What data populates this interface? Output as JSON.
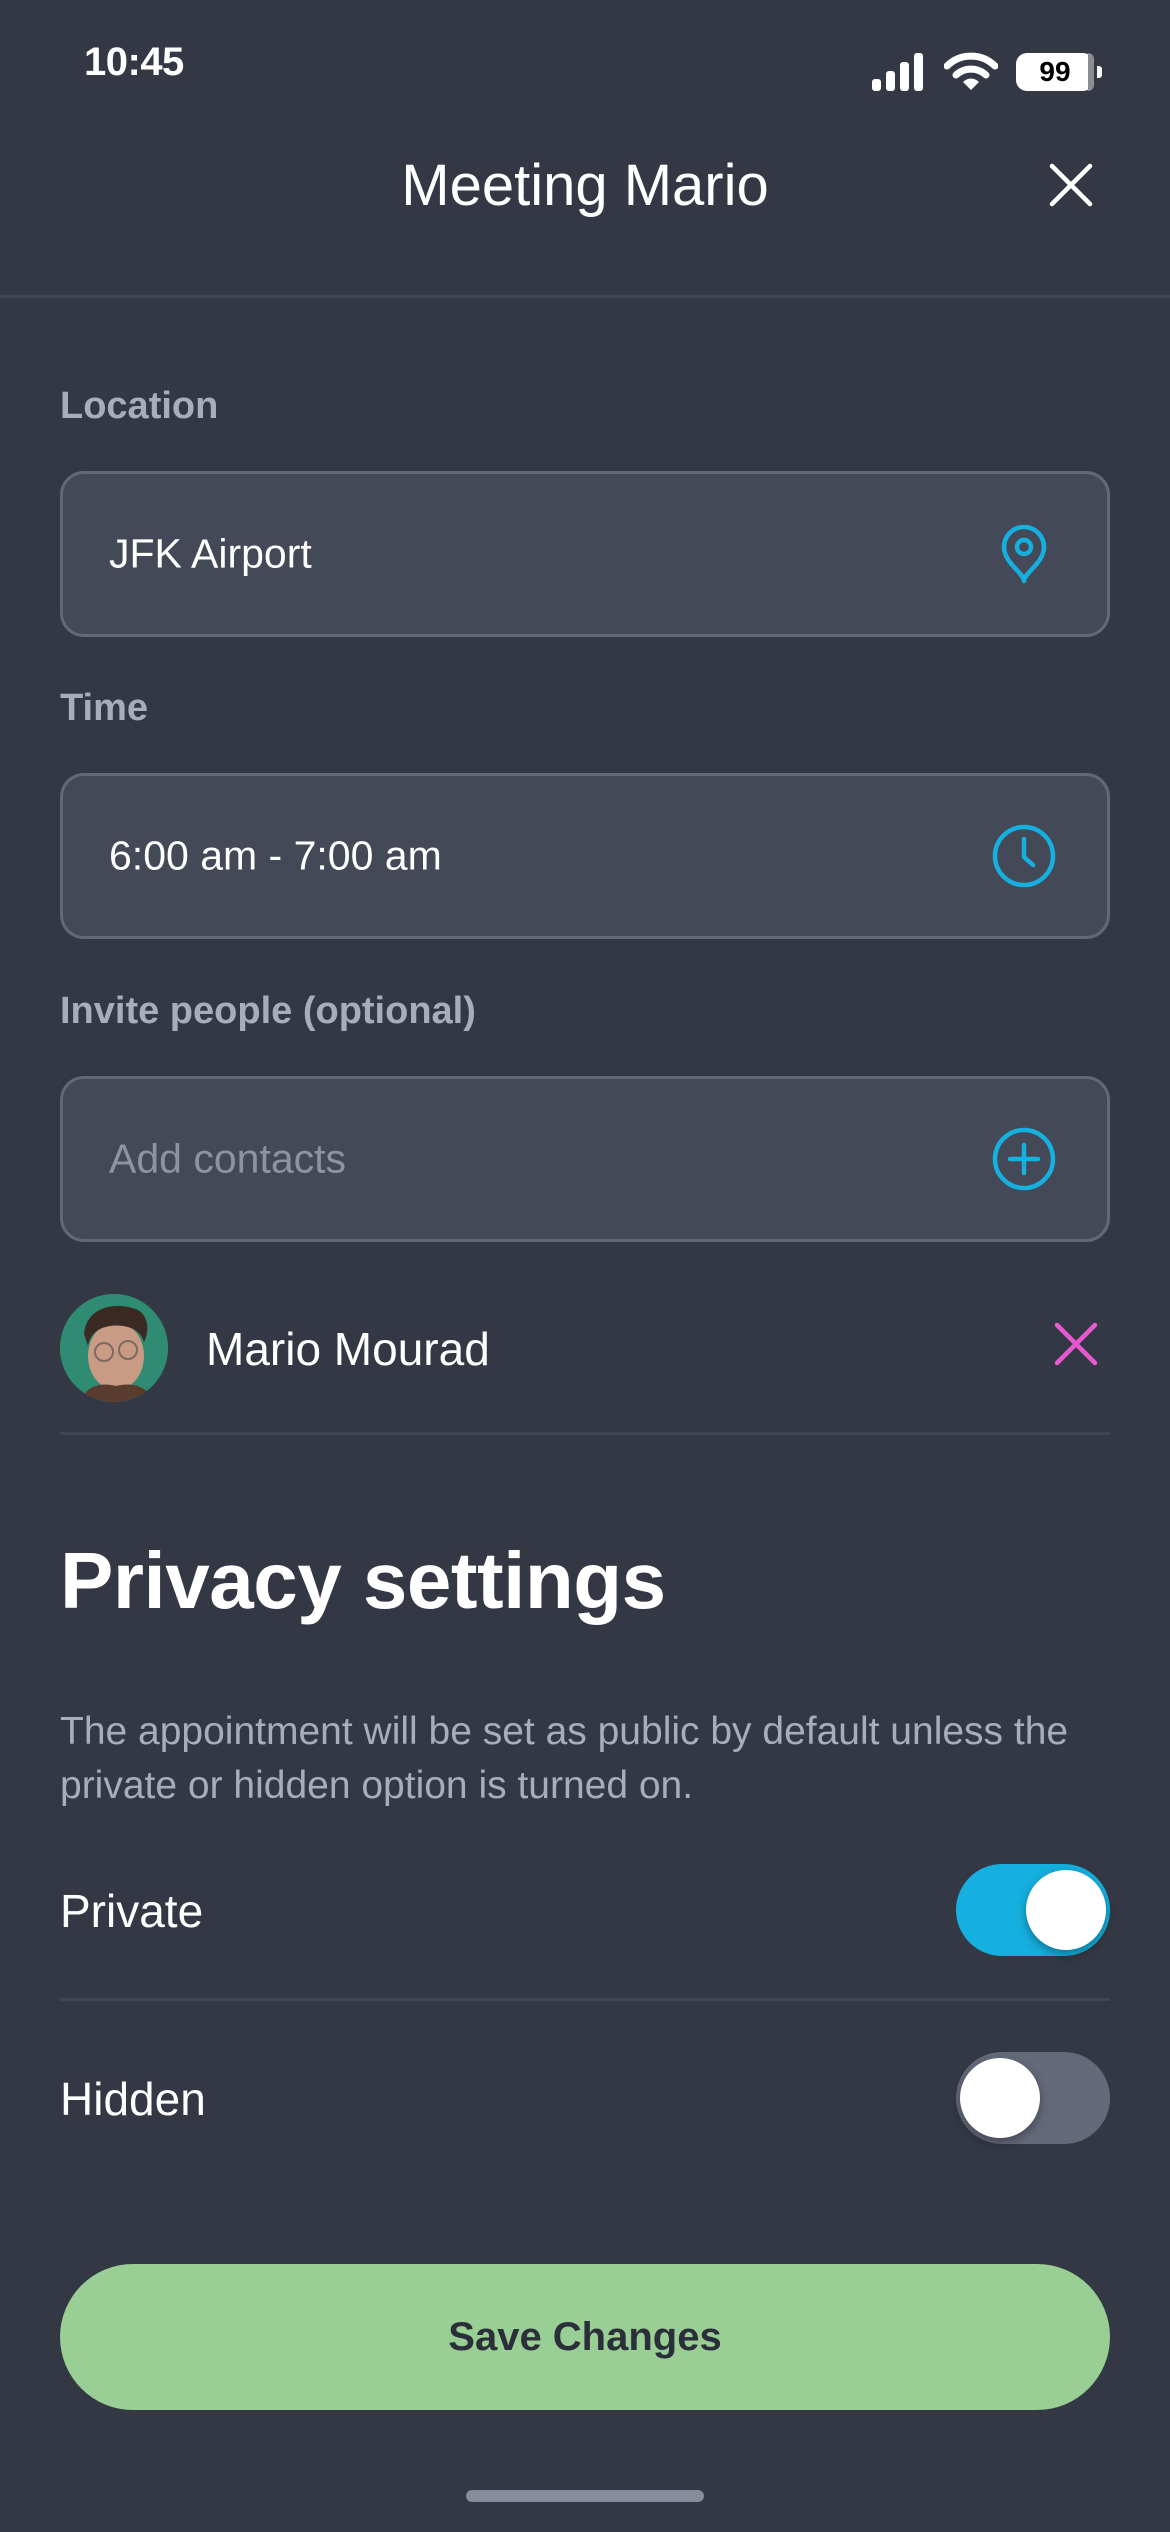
{
  "status_bar": {
    "time": "10:45",
    "battery": "99",
    "icons": [
      "signal-icon",
      "wifi-icon",
      "battery-icon"
    ]
  },
  "header": {
    "title": "Meeting Mario",
    "close_icon": "close-icon"
  },
  "form": {
    "location": {
      "label": "Location",
      "value": "JFK Airport",
      "icon": "map-pin-icon"
    },
    "time": {
      "label": "Time",
      "value": "6:00 am - 7:00 am",
      "icon": "clock-icon"
    },
    "invite": {
      "label": "Invite people (optional)",
      "placeholder": "Add contacts",
      "icon": "plus-circle-icon"
    }
  },
  "invitees": [
    {
      "name": "Mario Mourad",
      "avatar": "avatar-photo",
      "remove_icon": "remove-x-icon"
    }
  ],
  "privacy": {
    "title": "Privacy settings",
    "description": "The appointment will be set as public by default unless the private or hidden option is turned on.",
    "options": [
      {
        "label": "Private",
        "enabled": true
      },
      {
        "label": "Hidden",
        "enabled": false
      }
    ]
  },
  "actions": {
    "save_label": "Save Changes"
  },
  "colors": {
    "background": "#343844",
    "field_bg": "#434956",
    "field_border": "#626878",
    "accent_blue": "#15b0df",
    "remove_pink": "#e858d0",
    "save_green": "#99cf95",
    "label_gray": "#a7adbd"
  }
}
